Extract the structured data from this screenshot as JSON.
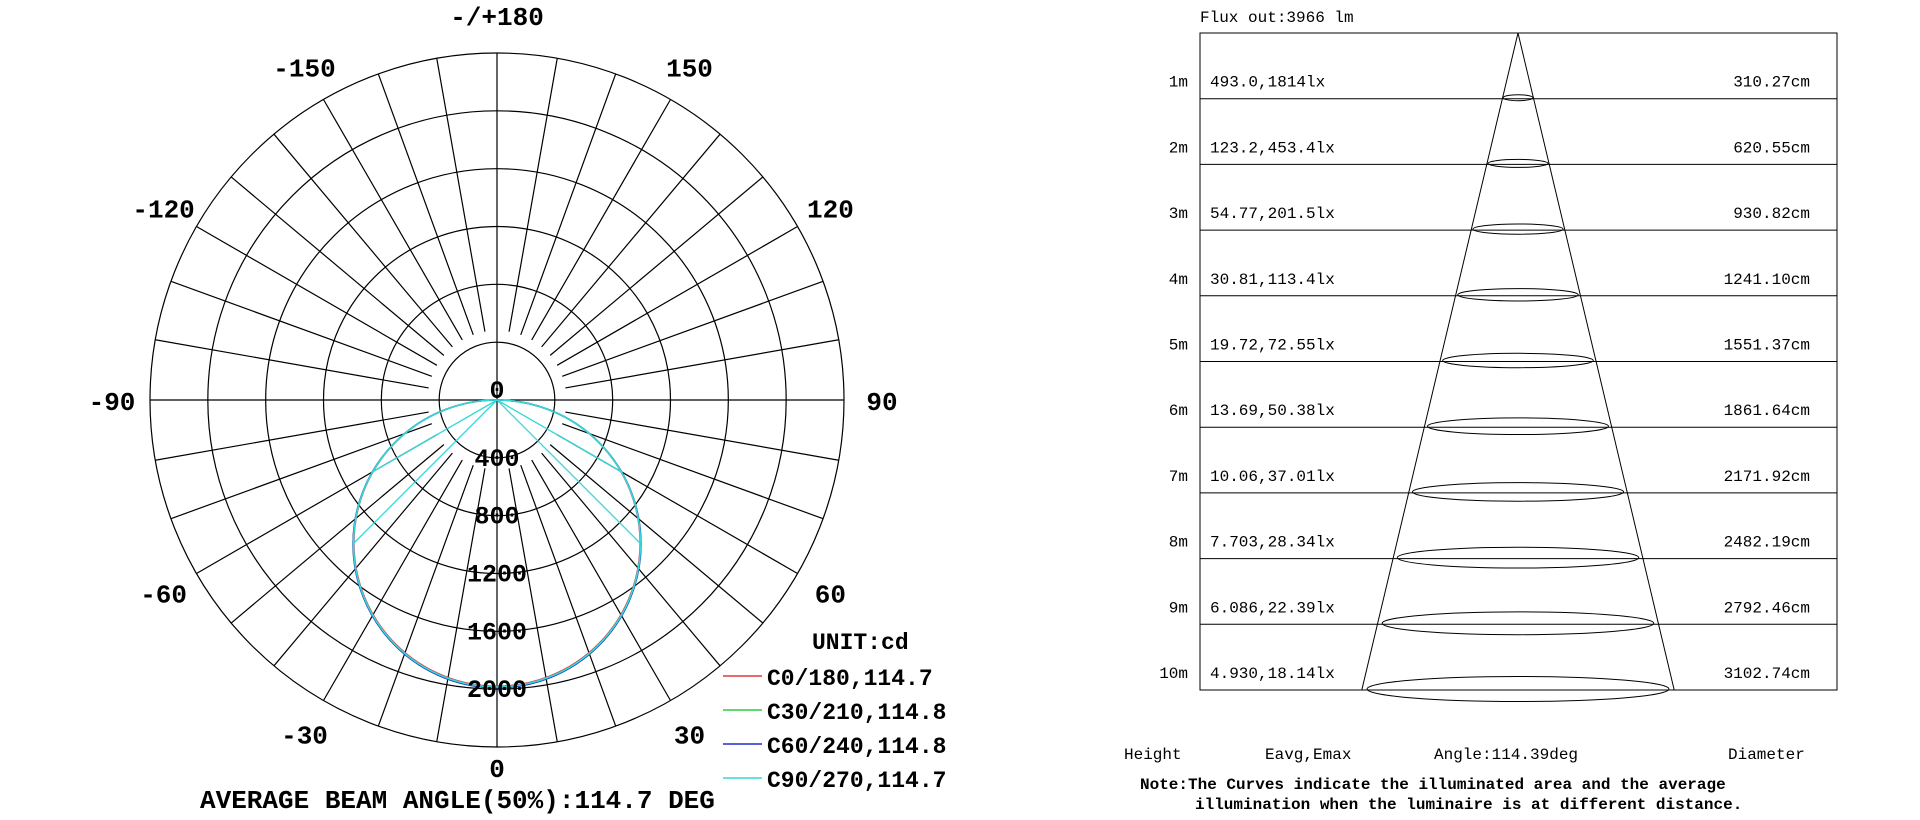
{
  "chart_data": [
    {
      "type": "polar",
      "angle_labels": [
        {
          "deg": 180,
          "text": "-/+180"
        },
        {
          "deg": -150,
          "text": "-150"
        },
        {
          "deg": 150,
          "text": "150"
        },
        {
          "deg": -120,
          "text": "-120"
        },
        {
          "deg": 120,
          "text": "120"
        },
        {
          "deg": -90,
          "text": "-90"
        },
        {
          "deg": 90,
          "text": "90"
        },
        {
          "deg": -60,
          "text": "-60"
        },
        {
          "deg": 60,
          "text": "60"
        },
        {
          "deg": -30,
          "text": "-30"
        },
        {
          "deg": 30,
          "text": "30"
        },
        {
          "deg": 0,
          "text": "0"
        }
      ],
      "radial_ticks": [
        0,
        400,
        800,
        1200,
        1600,
        2000
      ],
      "radial_tick_labels": [
        "0",
        "400",
        "800",
        "1200",
        "1600",
        "2000"
      ],
      "radial_max": 2400,
      "spoke_step_deg": 10,
      "unit_label": "UNIT:cd",
      "peak_intensity_cd": 1980,
      "series": [
        {
          "name": "C0/180,114.7",
          "color": "#e03a3a",
          "peak": 1980
        },
        {
          "name": "C30/210,114.8",
          "color": "#2ecc40",
          "peak": 1990
        },
        {
          "name": "C60/240,114.8",
          "color": "#1f2fd0",
          "peak": 1990
        },
        {
          "name": "C90/270,114.7",
          "color": "#35d8d8",
          "peak": 1985
        }
      ],
      "title": "AVERAGE BEAM ANGLE(50%):114.7 DEG"
    },
    {
      "type": "table",
      "flux_label": "Flux out:3966 lm",
      "rows": [
        {
          "height": "1m",
          "eavg_emax": "493.0,1814lx",
          "diameter": "310.27cm"
        },
        {
          "height": "2m",
          "eavg_emax": "123.2,453.4lx",
          "diameter": "620.55cm"
        },
        {
          "height": "3m",
          "eavg_emax": "54.77,201.5lx",
          "diameter": "930.82cm"
        },
        {
          "height": "4m",
          "eavg_emax": "30.81,113.4lx",
          "diameter": "1241.10cm"
        },
        {
          "height": "5m",
          "eavg_emax": "19.72,72.55lx",
          "diameter": "1551.37cm"
        },
        {
          "height": "6m",
          "eavg_emax": "13.69,50.38lx",
          "diameter": "1861.64cm"
        },
        {
          "height": "7m",
          "eavg_emax": "10.06,37.01lx",
          "diameter": "2171.92cm"
        },
        {
          "height": "8m",
          "eavg_emax": "7.703,28.34lx",
          "diameter": "2482.19cm"
        },
        {
          "height": "9m",
          "eavg_emax": "6.086,22.39lx",
          "diameter": "2792.46cm"
        },
        {
          "height": "10m",
          "eavg_emax": "4.930,18.14lx",
          "diameter": "3102.74cm"
        }
      ],
      "footer": {
        "height": "Height",
        "eavg_emax": "Eavg,Emax",
        "angle": "Angle:114.39deg",
        "diameter": "Diameter"
      },
      "note_line1": "Note:The Curves indicate the illuminated area and the average",
      "note_line2": "illumination when the luminaire is at different distance."
    }
  ]
}
